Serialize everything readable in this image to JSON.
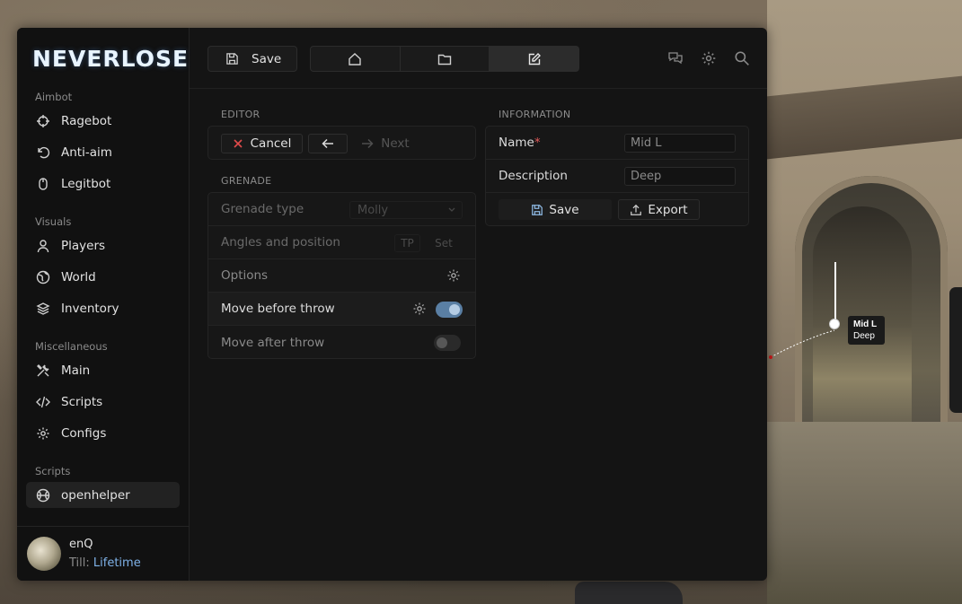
{
  "brand": {
    "logo_text": "NEVERLOSE"
  },
  "sidebar": {
    "sections": [
      {
        "title": "Aimbot",
        "items": [
          {
            "label": "Ragebot",
            "icon": "crosshair-icon"
          },
          {
            "label": "Anti-aim",
            "icon": "rotate-icon"
          },
          {
            "label": "Legitbot",
            "icon": "mouse-icon"
          }
        ]
      },
      {
        "title": "Visuals",
        "items": [
          {
            "label": "Players",
            "icon": "user-icon"
          },
          {
            "label": "World",
            "icon": "globe-icon"
          },
          {
            "label": "Inventory",
            "icon": "layers-icon"
          }
        ]
      },
      {
        "title": "Miscellaneous",
        "items": [
          {
            "label": "Main",
            "icon": "tools-icon"
          },
          {
            "label": "Scripts",
            "icon": "code-icon"
          },
          {
            "label": "Configs",
            "icon": "gear-icon"
          }
        ]
      },
      {
        "title": "Scripts",
        "items": [
          {
            "label": "openhelper",
            "icon": "basketball-icon",
            "active": true
          }
        ]
      }
    ]
  },
  "user": {
    "name": "enQ",
    "till_label": "Till:",
    "till_value": "Lifetime"
  },
  "topbar": {
    "save_label": "Save",
    "tabs": [
      {
        "icon": "home-icon"
      },
      {
        "icon": "folder-icon"
      },
      {
        "icon": "edit-icon",
        "active": true
      }
    ],
    "right_icons": [
      "chat-icon",
      "settings-icon",
      "search-icon"
    ]
  },
  "editor": {
    "title": "EDITOR",
    "cancel_label": "Cancel",
    "next_label": "Next"
  },
  "grenade": {
    "title": "GRENADE",
    "type_label": "Grenade type",
    "type_value": "Molly",
    "angles_label": "Angles and position",
    "tp_label": "TP",
    "set_label": "Set",
    "options_label": "Options",
    "move_before_label": "Move before throw",
    "move_before_on": true,
    "move_after_label": "Move after throw",
    "move_after_on": false
  },
  "information": {
    "title": "INFORMATION",
    "name_label": "Name",
    "name_required": "*",
    "name_value": "Mid L",
    "description_label": "Description",
    "description_value": "Deep",
    "save_label": "Save",
    "export_label": "Export"
  },
  "overlay": {
    "label_line1": "Mid L",
    "label_line2": "Deep"
  },
  "colors": {
    "accent": "#7fb2e8",
    "toggle_on": "#5a7fa4",
    "required": "#e05a5a",
    "cancel_x": "#e04b4b"
  }
}
